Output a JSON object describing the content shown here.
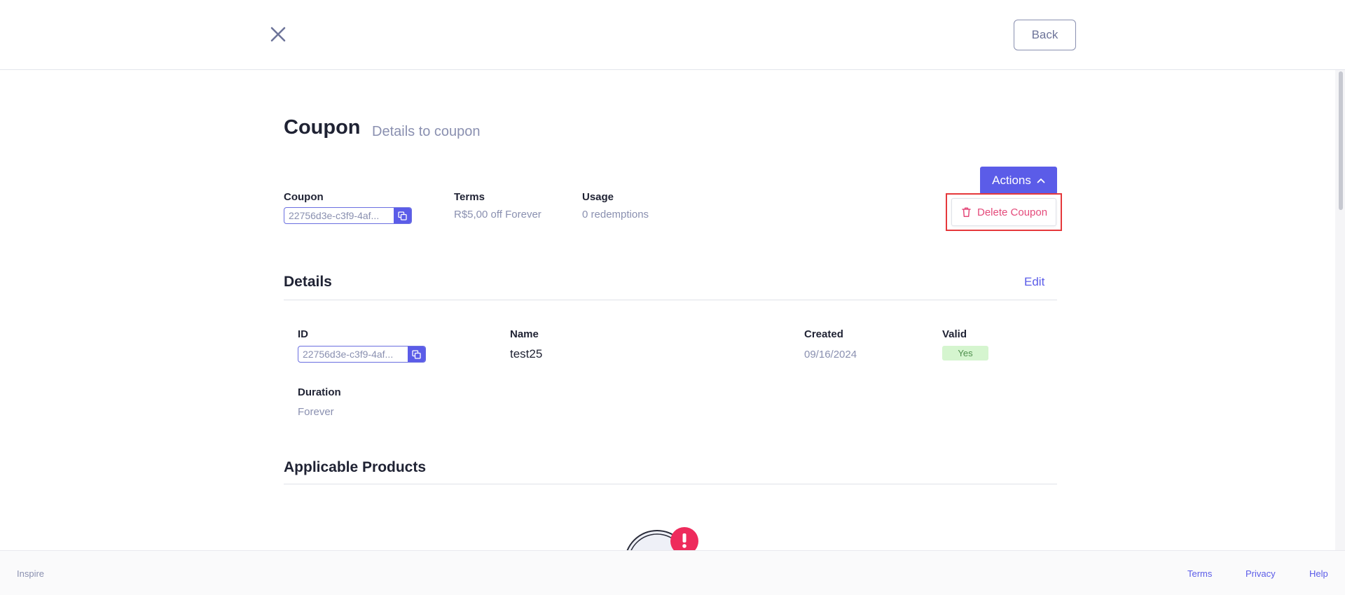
{
  "header": {
    "close_icon": "close-icon",
    "back_label": "Back"
  },
  "page": {
    "title": "Coupon",
    "subtitle": "Details to coupon"
  },
  "summary": {
    "coupon_label": "Coupon",
    "coupon_value": "22756d3e-c3f9-4af...",
    "terms_label": "Terms",
    "terms_value": "R$5,00 off Forever",
    "usage_label": "Usage",
    "usage_value": "0 redemptions"
  },
  "actions": {
    "label": "Actions",
    "menu": [
      {
        "label": "Delete Coupon",
        "icon": "trash-icon"
      }
    ]
  },
  "details": {
    "title": "Details",
    "edit_label": "Edit",
    "id_label": "ID",
    "id_value": "22756d3e-c3f9-4af...",
    "name_label": "Name",
    "name_value": "test25",
    "created_label": "Created",
    "created_value": "09/16/2024",
    "valid_label": "Valid",
    "valid_value": "Yes",
    "duration_label": "Duration",
    "duration_value": "Forever"
  },
  "applicable_products": {
    "title": "Applicable Products"
  },
  "footer": {
    "brand": "Inspire",
    "links": [
      "Terms",
      "Privacy",
      "Help"
    ]
  },
  "colors": {
    "accent": "#5b5ce8",
    "danger": "#e44a7a",
    "highlight": "#e5383b",
    "muted": "#8a90b0",
    "valid_badge_bg": "#d5f5cf"
  }
}
